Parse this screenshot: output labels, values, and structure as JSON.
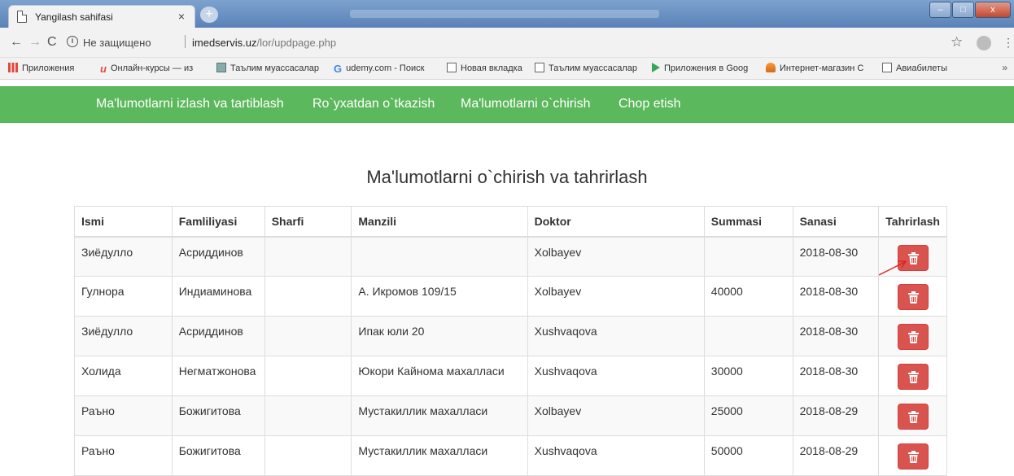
{
  "browser": {
    "tab_title": "Yangilash sahifasi",
    "tab_close": "×",
    "new_tab": "+",
    "security_label": "Не защищено",
    "url_host": "imedservis.uz",
    "url_path": "/lor/updpage.php",
    "window_controls": [
      "–",
      "□",
      "x"
    ]
  },
  "bookmarks": [
    {
      "icon": "apps-icon",
      "label": "Приложения"
    },
    {
      "icon": "u-logo-icon",
      "label": "Онлайн-курсы — из"
    },
    {
      "icon": "image-icon",
      "label": "Таълим муассасалар"
    },
    {
      "icon": "google-icon",
      "label": "udemy.com - Поиск"
    },
    {
      "icon": "document-icon",
      "label": "Новая вкладка"
    },
    {
      "icon": "document-icon",
      "label": "Таълим муассасалар"
    },
    {
      "icon": "play-store-icon",
      "label": "Приложения в Goog"
    },
    {
      "icon": "shop-icon",
      "label": "Интернет-магазин C"
    },
    {
      "icon": "document-icon",
      "label": "Авиабилеты"
    }
  ],
  "navbar": {
    "links": [
      "Ma'lumotlarni izlash va tartiblash",
      "Ro`yxatdan o`tkazish",
      "Ma'lumotlarni o`chirish",
      "Chop etish"
    ],
    "color": "#5cb85c"
  },
  "page": {
    "title": "Ma'lumotlarni o`chirish va tahrirlash"
  },
  "table": {
    "headers": [
      "Ismi",
      "Famliliyasi",
      "Sharfi",
      "Manzili",
      "Doktor",
      "Summasi",
      "Sanasi",
      "Tahrirlash"
    ],
    "rows": [
      {
        "ismi": "Зиёдулло",
        "familiya": "Асриддинов",
        "sharfi": "",
        "manzili": "",
        "doktor": "Xolbayev",
        "summasi": "",
        "sanasi": "2018-08-30"
      },
      {
        "ismi": "Гулнора",
        "familiya": "Индиаминова",
        "sharfi": "",
        "manzili": "А. Икромов 109/15",
        "doktor": "Xolbayev",
        "summasi": "40000",
        "sanasi": "2018-08-30"
      },
      {
        "ismi": "Зиёдулло",
        "familiya": "Асриддинов",
        "sharfi": "",
        "manzili": "Ипак юли 20",
        "doktor": "Xushvaqova",
        "summasi": "",
        "sanasi": "2018-08-30"
      },
      {
        "ismi": "Холида",
        "familiya": "Негматжонова",
        "sharfi": "",
        "manzili": "Юкори Кайнома махалласи",
        "doktor": "Xushvaqova",
        "summasi": "30000",
        "sanasi": "2018-08-30"
      },
      {
        "ismi": "Раъно",
        "familiya": "Божигитова",
        "sharfi": "",
        "manzili": "Мустакиллик махалласи",
        "doktor": "Xolbayev",
        "summasi": "25000",
        "sanasi": "2018-08-29"
      },
      {
        "ismi": "Раъно",
        "familiya": "Божигитова",
        "sharfi": "",
        "manzili": "Мустакиллик махалласи",
        "doktor": "Xushvaqova",
        "summasi": "50000",
        "sanasi": "2018-08-29"
      }
    ],
    "delete_button_color": "#d9534f"
  }
}
